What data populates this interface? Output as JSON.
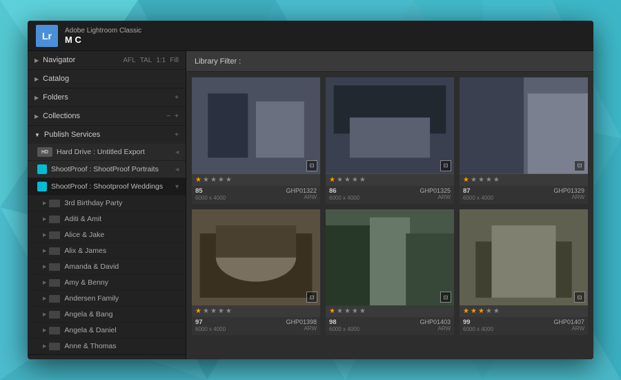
{
  "app": {
    "logo": "Lr",
    "app_name": "Adobe Lightroom Classic",
    "user": "M C"
  },
  "sidebar": {
    "sections": [
      {
        "id": "navigator",
        "label": "Navigator",
        "open": false,
        "controls": "AFL TAL 1:1 Fill"
      },
      {
        "id": "catalog",
        "label": "Catalog",
        "open": false
      },
      {
        "id": "folders",
        "label": "Folders",
        "open": false,
        "has_plus": true
      },
      {
        "id": "collections",
        "label": "Collections",
        "open": false,
        "has_minus": true,
        "has_plus": true
      },
      {
        "id": "publish_services",
        "label": "Publish Services",
        "open": true,
        "has_plus": true
      }
    ],
    "publish_items": [
      {
        "id": "hard_drive",
        "type": "hd",
        "label": "Hard Drive : Untitled Export",
        "arrow": "◄"
      },
      {
        "id": "shootproof1",
        "type": "sp",
        "label": "ShootProof : ShootProof Portraits",
        "arrow": "◄",
        "active": false
      },
      {
        "id": "shootproof2",
        "type": "sp",
        "label": "ShootProof : Shootproof Weddings",
        "arrow": "▼",
        "active": true
      }
    ],
    "sub_items": [
      "3rd Birthday Party",
      "Aditi & Amit",
      "Alice & Jake",
      "Alix & James",
      "Amanda & David",
      "Amy & Benny",
      "Andersen Family",
      "Angela & Bang",
      "Angela & Daniel",
      "Anne & Thomas"
    ]
  },
  "filter_bar": {
    "label": "Library Filter :"
  },
  "photos": [
    {
      "num": "85",
      "id": "GHP01322",
      "ext": "ARW",
      "dim": "6000 x 4000",
      "rating": 1,
      "max_rating": 5,
      "has_badge": true,
      "color": "#5a6a7a"
    },
    {
      "num": "86",
      "id": "GHP01325",
      "ext": "ARW",
      "dim": "6000 x 4000",
      "rating": 1,
      "max_rating": 5,
      "has_badge": true,
      "color": "#4a5a6a"
    },
    {
      "num": "87",
      "id": "GHP01329",
      "ext": "ARW",
      "dim": "6000 x 4000",
      "rating": 1,
      "max_rating": 5,
      "has_badge": true,
      "color": "#6a7a8a"
    },
    {
      "num": "97",
      "id": "GHP01398",
      "ext": "ARW",
      "dim": "6000 x 4000",
      "rating": 1,
      "max_rating": 5,
      "has_badge": true,
      "color": "#7a6a5a"
    },
    {
      "num": "98",
      "id": "GHP01403",
      "ext": "ARW",
      "dim": "6000 x 4000",
      "rating": 1,
      "max_rating": 5,
      "has_badge": true,
      "color": "#6a7a6a"
    },
    {
      "num": "99",
      "id": "GHP01407",
      "ext": "ARW",
      "dim": "6000 x 4000",
      "rating": 3,
      "max_rating": 5,
      "has_badge": true,
      "color": "#8a8a7a"
    }
  ]
}
